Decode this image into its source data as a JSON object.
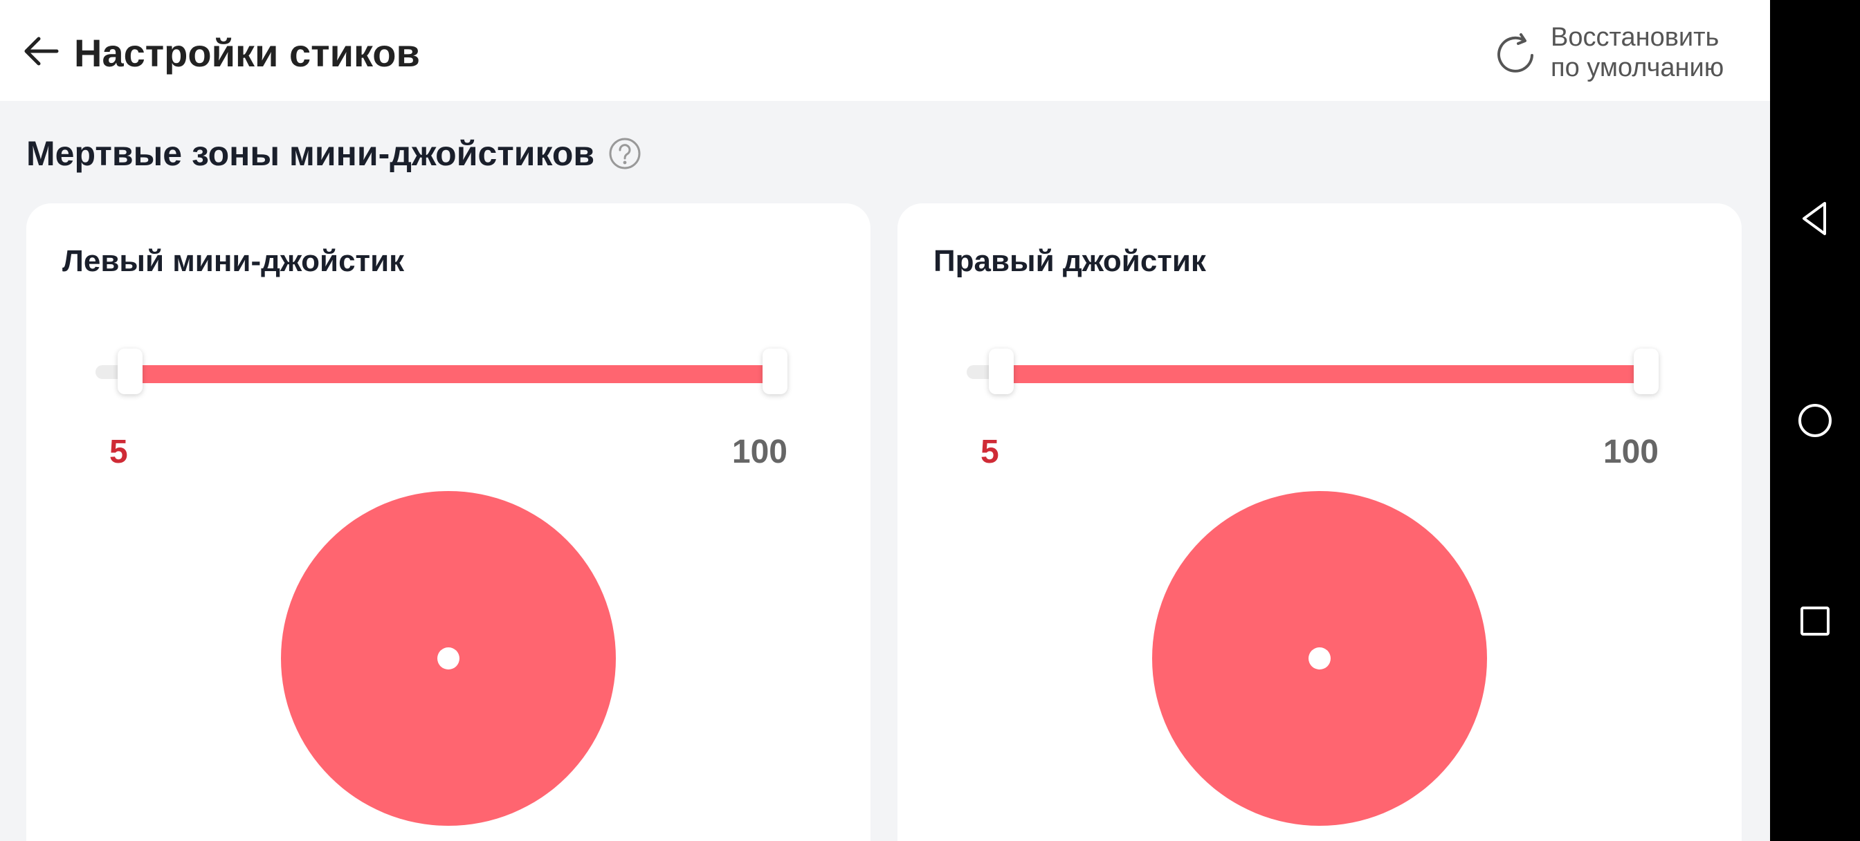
{
  "header": {
    "title": "Настройки стиков",
    "back_icon": "arrow-left-icon",
    "restore_icon": "refresh-icon",
    "restore_line1": "Восстановить",
    "restore_line2": "по умолчанию"
  },
  "section": {
    "title": "Мертвые зоны мини-джойстиков",
    "help_icon": "help-circle-icon"
  },
  "cards": [
    {
      "title": "Левый мини-джойстик",
      "min_value": "5",
      "max_value": "100",
      "range": [
        5,
        100
      ],
      "scale": [
        0,
        100
      ]
    },
    {
      "title": "Правый джойстик",
      "min_value": "5",
      "max_value": "100",
      "range": [
        5,
        100
      ],
      "scale": [
        0,
        100
      ]
    }
  ],
  "colors": {
    "accent": "#ff6570",
    "min_text": "#cf2b36",
    "max_text": "#666666",
    "track": "#ececec"
  },
  "navbar": {
    "back_icon": "triangle-back-icon",
    "home_icon": "circle-home-icon",
    "recents_icon": "square-recents-icon"
  }
}
